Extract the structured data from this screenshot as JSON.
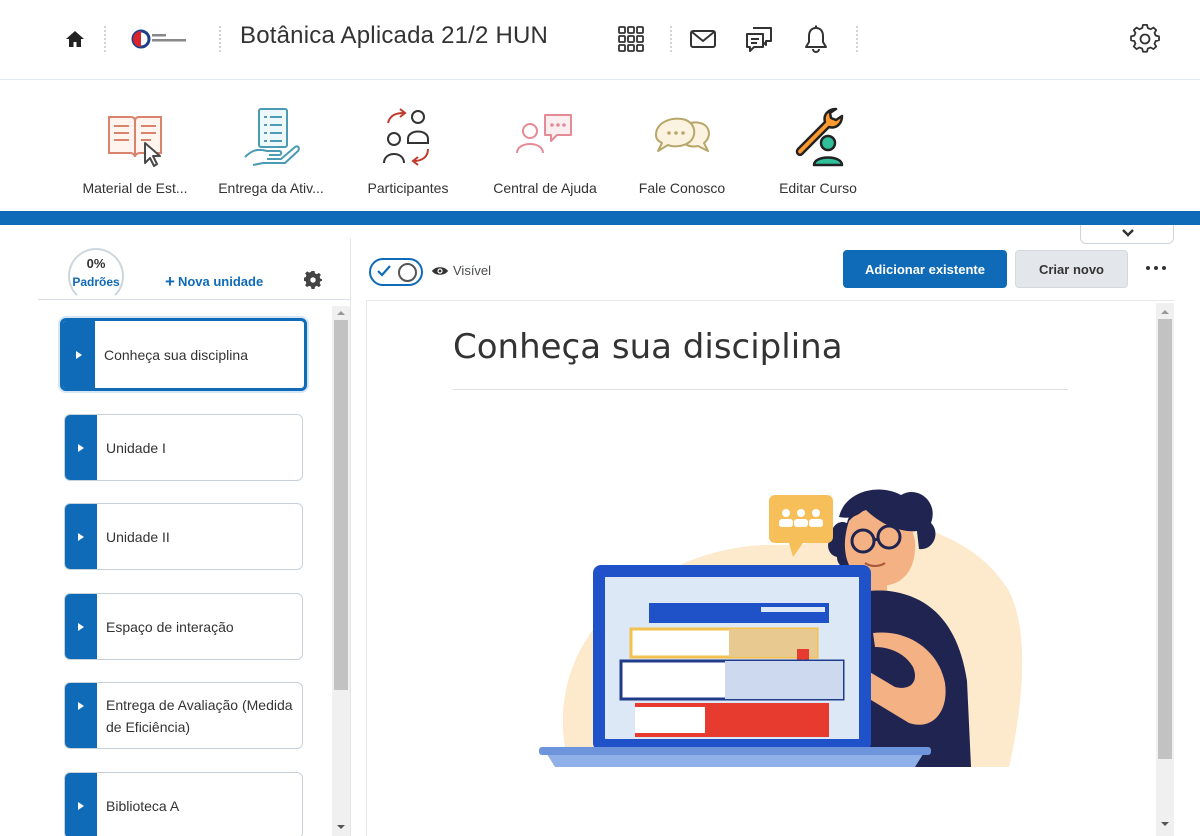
{
  "header": {
    "course_title": "Botânica Aplicada 21/2 HUN",
    "logo_text": "GRUPO TIRADENTES",
    "icons": [
      "home-icon",
      "grid-icon",
      "mail-icon",
      "chat-icon",
      "bell-icon",
      "settings-icon"
    ]
  },
  "navbar": {
    "items": [
      {
        "label": "Material de Est...",
        "icon": "book-icon"
      },
      {
        "label": "Entrega da Ativ...",
        "icon": "checklist-icon"
      },
      {
        "label": "Participantes",
        "icon": "participants-icon"
      },
      {
        "label": "Central de Ajuda",
        "icon": "help-chat-icon"
      },
      {
        "label": "Fale Conosco",
        "icon": "speech-bubbles-icon"
      },
      {
        "label": "Editar Curso",
        "icon": "wrench-user-icon"
      }
    ],
    "accent_color": "#0f6bb8"
  },
  "left_panel": {
    "progress_value": "0%",
    "progress_label": "Padrões",
    "new_unit_label": "Nova unidade",
    "units": [
      {
        "label": "Conheça sua disciplina",
        "selected": true
      },
      {
        "label": "Unidade I",
        "selected": false
      },
      {
        "label": "Unidade II",
        "selected": false
      },
      {
        "label": "Espaço de interação",
        "selected": false
      },
      {
        "label": "Entrega de Avaliação (Medida de Eficiência)",
        "selected": false
      },
      {
        "label": "Biblioteca A",
        "selected": false
      }
    ]
  },
  "toolbar": {
    "visibility_label": "Visível",
    "add_existing_label": "Adicionar existente",
    "create_new_label": "Criar novo"
  },
  "content": {
    "title": "Conheça sua disciplina"
  }
}
